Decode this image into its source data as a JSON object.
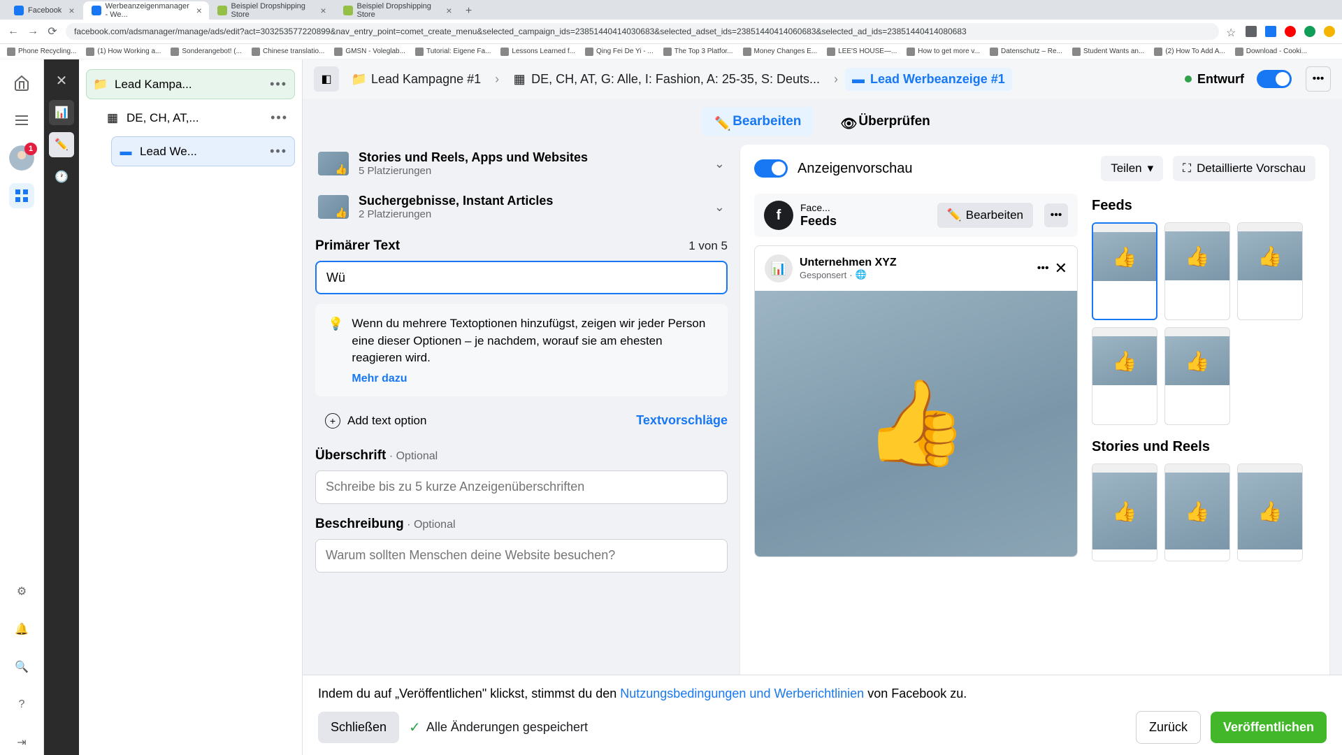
{
  "browser": {
    "tabs": [
      {
        "label": "Facebook"
      },
      {
        "label": "Werbeanzeigenmanager - We..."
      },
      {
        "label": "Beispiel Dropshipping Store"
      },
      {
        "label": "Beispiel Dropshipping Store"
      }
    ],
    "url": "facebook.com/adsmanager/manage/ads/edit?act=303253577220899&nav_entry_point=comet_create_menu&selected_campaign_ids=23851440414030683&selected_adset_ids=23851440414060683&selected_ad_ids=23851440414080683",
    "bookmarks": [
      "Phone Recycling...",
      "(1) How Working a...",
      "Sonderangebot! (...",
      "Chinese translatio...",
      "GMSN - Voleglab...",
      "Tutorial: Eigene Fa...",
      "Lessons Learned f...",
      "Qing Fei De Yi - ...",
      "The Top 3 Platfor...",
      "Money Changes E...",
      "LEE'S HOUSE—...",
      "How to get more v...",
      "Datenschutz – Re...",
      "Student Wants an...",
      "(2) How To Add A...",
      "Download - Cooki..."
    ]
  },
  "rail": {
    "badge": "1"
  },
  "tree": {
    "campaign": "Lead Kampa...",
    "adset": "DE, CH, AT,...",
    "ad": "Lead We..."
  },
  "breadcrumb": {
    "campaign": "Lead Kampagne #1",
    "adset": "DE, CH, AT, G: Alle, I: Fashion, A: 25-35, S: Deuts...",
    "ad": "Lead Werbeanzeige #1",
    "status": "Entwurf"
  },
  "tabs": {
    "edit": "Bearbeiten",
    "review": "Überprüfen"
  },
  "placements": {
    "p1_title": "Stories und Reels, Apps und Websites",
    "p1_sub": "5 Platzierungen",
    "p2_title": "Suchergebnisse, Instant Articles",
    "p2_sub": "2 Platzierungen"
  },
  "form": {
    "primary_label": "Primärer Text",
    "primary_count": "1 von 5",
    "primary_value": "Wü",
    "info": "Wenn du mehrere Textoptionen hinzufügst, zeigen wir jeder Person eine dieser Optionen – je nachdem, worauf sie am ehesten reagieren wird.",
    "info_link": "Mehr dazu",
    "add_option": "Add text option",
    "text_suggest": "Textvorschläge",
    "headline_label": "Überschrift",
    "optional": "Optional",
    "headline_placeholder": "Schreibe bis zu 5 kurze Anzeigenüberschriften",
    "description_label": "Beschreibung",
    "description_placeholder": "Warum sollten Menschen deine Website besuchen?"
  },
  "preview": {
    "title": "Anzeigenvorschau",
    "share": "Teilen",
    "detailed": "Detaillierte Vorschau",
    "story_sm": "Face...",
    "story_lg": "Feeds",
    "edit": "Bearbeiten",
    "post_name": "Unternehmen XYZ",
    "post_sub": "Gesponsert",
    "side_feeds": "Feeds",
    "side_stories": "Stories und Reels"
  },
  "footer": {
    "text_pre": "Indem du auf „Veröffentlichen\" klickst, stimmst du den ",
    "link": "Nutzungsbedingungen und Werberichtlinien",
    "text_post": " von Facebook zu.",
    "close": "Schließen",
    "saved": "Alle Änderungen gespeichert",
    "back": "Zurück",
    "publish": "Veröffentlichen"
  }
}
